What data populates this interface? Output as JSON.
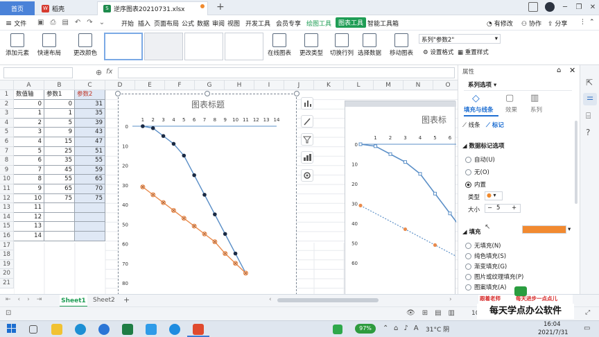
{
  "tabs": {
    "home": "首页",
    "wps": "稻壳",
    "doc": "逆序图表20210731.xlsx",
    "add": "+"
  },
  "window": {
    "min": "─",
    "restore": "❐",
    "close": "✕"
  },
  "menu": {
    "file": "文件",
    "items": [
      "开始",
      "插入",
      "页面布局",
      "公式",
      "数据",
      "审阅",
      "视图",
      "开发工具",
      "会员专享"
    ],
    "draw_tools": "绘图工具",
    "chart_tools": "图表工具",
    "smart_tools": "智能工具箱",
    "edit": "有修改",
    "collab": "协作",
    "share": "分享"
  },
  "ribbon": {
    "add_element": "添加元素",
    "quick_layout": "快速布局",
    "change_color": "更改颜色",
    "online_chart": "在线图表",
    "change_type": "更改类型",
    "switch_rowcol": "切换行列",
    "select_data": "选择数据",
    "move_chart": "移动图表",
    "series_select": "系列\"参数2\"",
    "format_setting": "设置格式",
    "reset_style": "重置样式"
  },
  "formula": {
    "fx": "fx"
  },
  "sheet": {
    "columns": [
      "A",
      "B",
      "C",
      "D",
      "E",
      "F",
      "G",
      "H",
      "I",
      "J",
      "K",
      "L",
      "M",
      "N",
      "O"
    ],
    "rows": [
      [
        "数值轴",
        "参数1",
        "参数2"
      ],
      [
        "0",
        "0",
        "31"
      ],
      [
        "1",
        "1",
        "35"
      ],
      [
        "2",
        "5",
        "39"
      ],
      [
        "3",
        "9",
        "43"
      ],
      [
        "4",
        "15",
        "47"
      ],
      [
        "5",
        "25",
        "51"
      ],
      [
        "6",
        "35",
        "55"
      ],
      [
        "7",
        "45",
        "59"
      ],
      [
        "8",
        "55",
        "65"
      ],
      [
        "9",
        "65",
        "70"
      ],
      [
        "10",
        "75",
        "75"
      ],
      [
        "11",
        "",
        ""
      ],
      [
        "12",
        "",
        ""
      ],
      [
        "13",
        "",
        ""
      ],
      [
        "14",
        "",
        ""
      ]
    ]
  },
  "chart_data": {
    "type": "line",
    "title": "图表标题",
    "x_axis_ticks": [
      "1",
      "2",
      "3",
      "4",
      "5",
      "6",
      "7",
      "8",
      "9",
      "10",
      "11",
      "12",
      "13",
      "14"
    ],
    "y_axis_ticks": [
      "0",
      "10",
      "20",
      "30",
      "40",
      "50",
      "60",
      "70",
      "80"
    ],
    "ylim": [
      0,
      80
    ],
    "y_reversed": true,
    "x_top": true,
    "series": [
      {
        "x": [
          1,
          2,
          3,
          4,
          5,
          6,
          7,
          8,
          9,
          10,
          11
        ],
        "values": [
          0,
          1,
          5,
          9,
          15,
          25,
          35,
          45,
          55,
          65,
          75
        ],
        "color": "#5b8fc7",
        "marker": "#1a2a44"
      },
      {
        "x": [
          1,
          2,
          3,
          4,
          5,
          6,
          7,
          8,
          9,
          10,
          11
        ],
        "values": [
          31,
          35,
          39,
          43,
          47,
          51,
          55,
          59,
          65,
          70,
          75
        ],
        "color": "#e98b4d",
        "marker": "#e98b4d"
      }
    ]
  },
  "chart2": {
    "title": "图表标",
    "x_ticks": [
      "1",
      "2",
      "3",
      "4",
      "5",
      "6",
      "7"
    ],
    "y_ticks": [
      "0",
      "10",
      "20",
      "30",
      "40",
      "50",
      "60"
    ]
  },
  "panel": {
    "title": "属性",
    "series_options": "系列选项",
    "tab_fill": "填充与线条",
    "tab_effect": "效果",
    "tab_series": "系列",
    "line": "线条",
    "marker": "标记",
    "marker_options": "数据标记选项",
    "auto": "自动(U)",
    "none": "无(O)",
    "builtin": "内置",
    "type_label": "类型",
    "size_label": "大小",
    "size_value": "5",
    "fill": "填充",
    "fill_color": "#f28a30",
    "no_fill": "无填充(N)",
    "solid_fill": "纯色填充(S)",
    "gradient_fill": "渐变填充(G)",
    "picture_fill": "图片或纹理填充(P)",
    "pattern_fill": "图案填充(A)"
  },
  "sheet_tabs": {
    "sheet1": "Sheet1",
    "sheet2": "Sheet2"
  },
  "status": {
    "zoom": "10"
  },
  "watermark": {
    "red_left": "跟着老师",
    "red_right": "每天进步一点点儿",
    "main": "每天学点办公软件"
  },
  "taskbar": {
    "battery": "97%",
    "weather": "31°C 阴",
    "time": "16:04",
    "date": "2021/7/31"
  }
}
